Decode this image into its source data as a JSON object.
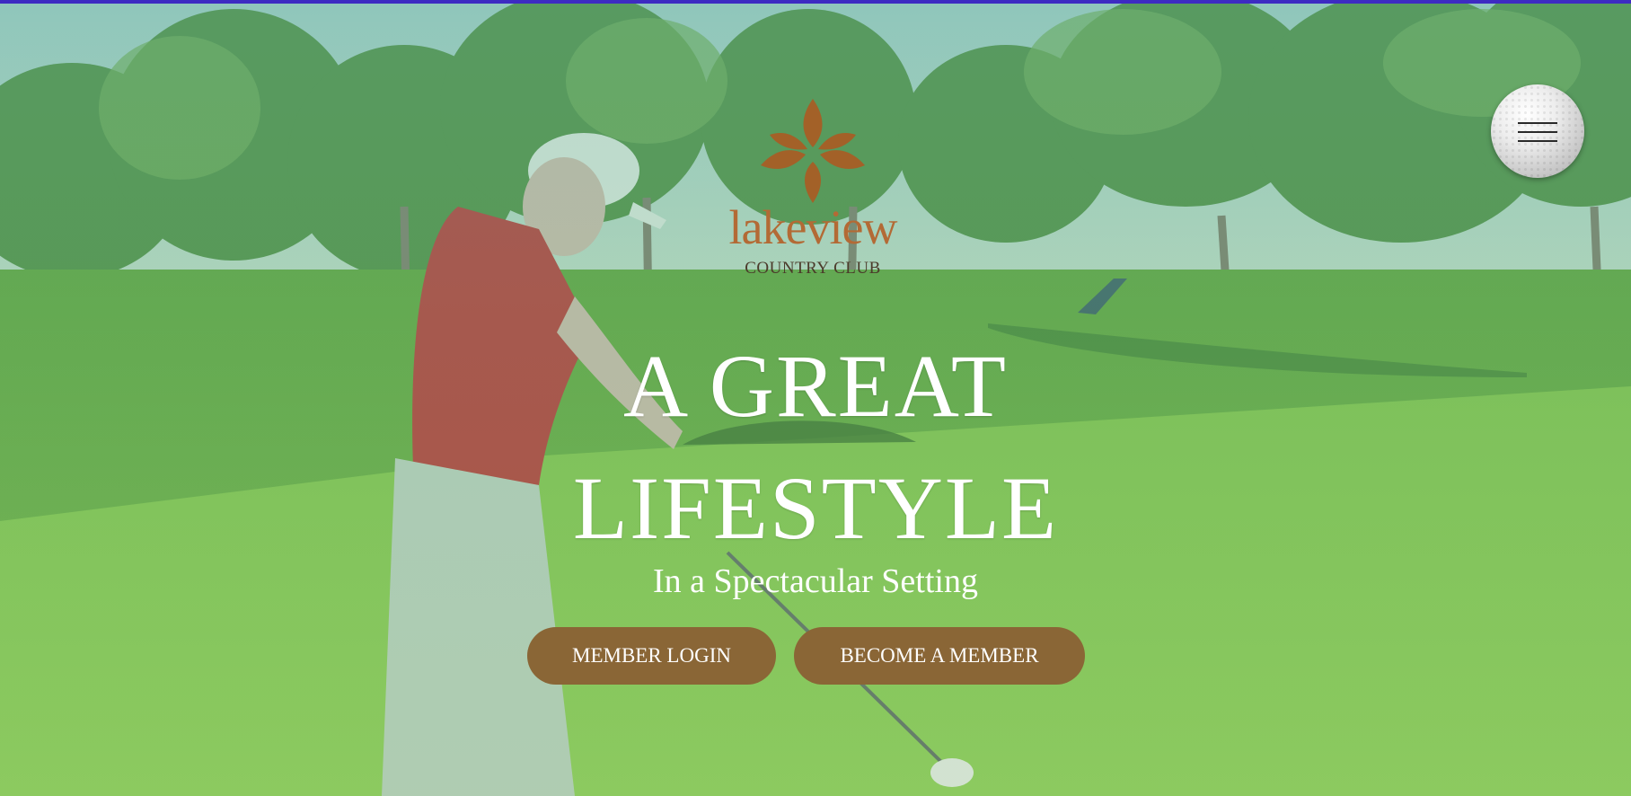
{
  "logo": {
    "name": "lakeview",
    "subtitle": "COUNTRY CLUB"
  },
  "menu": {
    "icon": "hamburger-menu-icon"
  },
  "hero": {
    "headline_line1": "A GREAT",
    "headline_line2": "LIFESTYLE",
    "subheadline": "In a Spectacular Setting"
  },
  "buttons": {
    "member_login": "MEMBER LOGIN",
    "become_member": "BECOME A MEMBER"
  },
  "colors": {
    "accent": "#8a6636",
    "logo_text": "#b36a35",
    "top_bar": "#3d2bc2"
  }
}
